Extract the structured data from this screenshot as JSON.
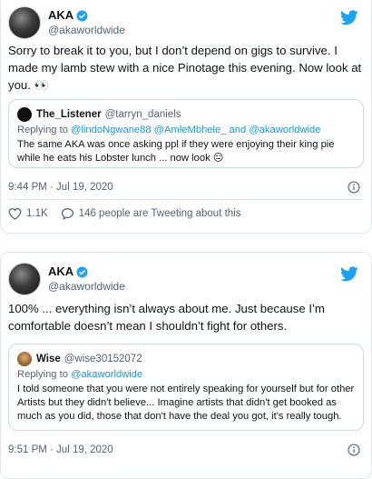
{
  "tweets": [
    {
      "author": {
        "name": "AKA",
        "handle": "@akaworldwide",
        "verified": true
      },
      "text": "Sorry to break it to you, but I don’t depend on gigs to survive. I made my lamb stew with a nice Pinotage this evening. Now look at you. 👀",
      "quote": {
        "name": "The_Listener",
        "handle": "@tarryn_daniels",
        "reply_prefix": "Replying to",
        "reply_to": "@lindoNgwane88 @AmleMbhele_ and @akaworldwide",
        "text": "The same AKA was once asking ppl if they were enjoying their king pie while he eats his Lobster lunch ... now look 😑"
      },
      "timestamp": "9:44 PM · Jul 19, 2020",
      "likes": "1.1K",
      "tweeting_about": "146 people are Tweeting about this"
    },
    {
      "author": {
        "name": "AKA",
        "handle": "@akaworldwide",
        "verified": true
      },
      "text": "100% ... everything isn’t always about me. Just because I’m comfortable doesn’t mean I shouldn’t fight for others.",
      "quote": {
        "name": "Wise",
        "handle": "@wise30152072",
        "reply_prefix": "Replying to",
        "reply_to": "@akaworldwide",
        "text": "I told someone that you were not entirely speaking for yourself but for other Artists but they didn't believe... Imagine artists that didn't get booked as much as you did, those that don't have the deal you got, it's really tough."
      },
      "timestamp": "9:51 PM · Jul 19, 2020"
    }
  ],
  "colors": {
    "twitter_blue": "#1da1f2",
    "link": "#1b95e0",
    "secondary_text": "#536471",
    "border": "#e1e8ed"
  },
  "icons": [
    "twitter-bird-icon",
    "verified-badge-icon",
    "info-icon",
    "heart-icon",
    "comment-icon"
  ]
}
